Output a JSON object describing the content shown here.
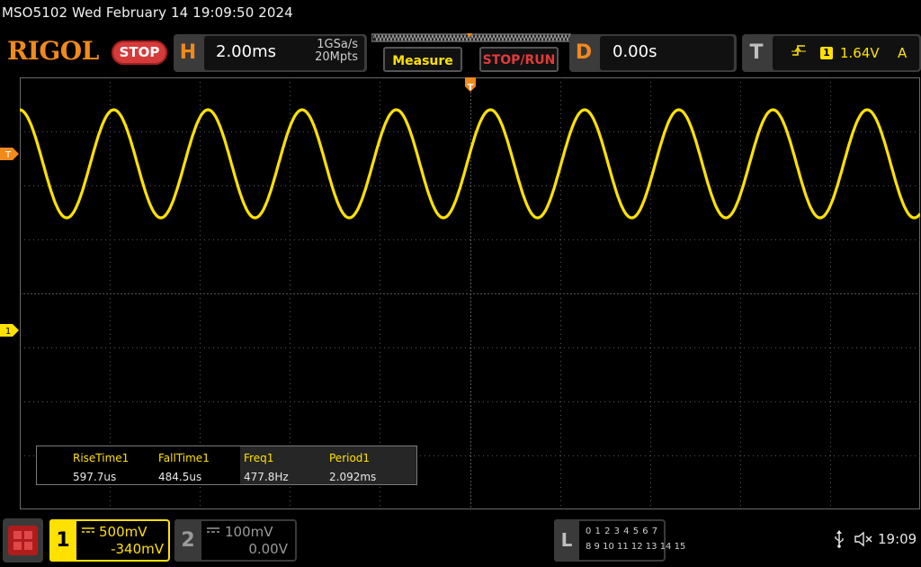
{
  "title": "MSO5102  Wed February 14 19:09:50 2024",
  "brand": "RIGOL",
  "status": "STOP",
  "horizontal": {
    "key": "H",
    "timebase": "2.00ms",
    "sample_rate": "1GSa/s",
    "memory_depth": "20Mpts"
  },
  "buttons": {
    "measure": "Measure",
    "stop_run": "STOP/RUN"
  },
  "delay": {
    "key": "D",
    "value": "0.00s"
  },
  "trigger": {
    "key": "T",
    "edge_icon": "rising-edge-icon",
    "source": "1",
    "level": "1.64V",
    "mode": "A"
  },
  "markers": {
    "trigger_level": "T",
    "channel1": "1",
    "trigger_position": "T"
  },
  "measurements": [
    {
      "name": "RiseTime1",
      "value": "597.7us",
      "highlight": false
    },
    {
      "name": "FallTime1",
      "value": "484.5us",
      "highlight": false
    },
    {
      "name": "Freq1",
      "value": "477.8Hz",
      "highlight": true
    },
    {
      "name": "Period1",
      "value": "2.092ms",
      "highlight": true
    }
  ],
  "channel1": {
    "number": "1",
    "scale": "500mV",
    "offset": "-340mV",
    "color": "#ffe100"
  },
  "channel2": {
    "number": "2",
    "scale": "100mV",
    "offset": "0.00V",
    "color": "#9a9a9a"
  },
  "logic": {
    "key": "L",
    "row1": "0 1 2 3  4 5 6 7",
    "row2": "8  9 10 11  12 13 14 15"
  },
  "clock": "19:09",
  "waveform": {
    "type": "sine",
    "frequency_hz": 477.8,
    "period_ms": 2.092,
    "time_per_div_ms": 2.0,
    "volts_per_div": 0.5,
    "channel_offset_v": -0.34,
    "trigger_level_v": 1.64,
    "horizontal_divisions": 10,
    "vertical_divisions": 8,
    "max_v": 2.04,
    "min_v": 1.04
  },
  "colors": {
    "accent": "#f08a1c",
    "channel1": "#ffe100",
    "stop": "#d63b3b",
    "grid": "#555555"
  }
}
